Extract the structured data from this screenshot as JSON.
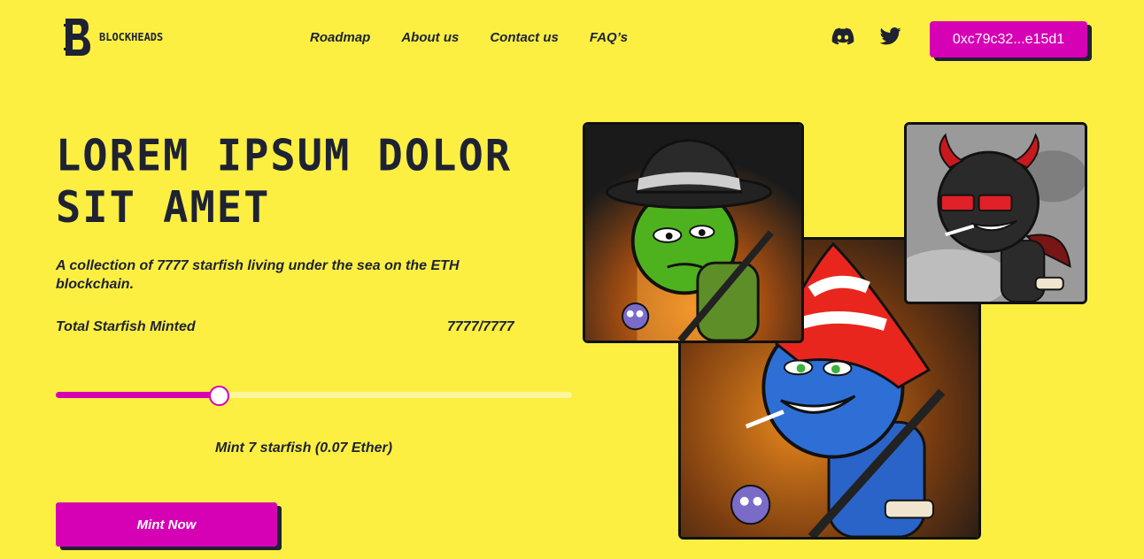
{
  "header": {
    "logo_text": "BLOCKHEADS",
    "nav": [
      "Roadmap",
      "About us",
      "Contact us",
      "FAQ’s"
    ],
    "social_icons": [
      "discord-icon",
      "twitter-icon"
    ],
    "wallet_address": "0xc79c32...e15d1"
  },
  "hero": {
    "title": "LOREM IPSUM DOLOR SIT AMET",
    "subtitle": "A collection of 7777 starfish living under the sea on the ETH blockchain.",
    "minted_label": "Total Starfish Minted",
    "minted_value": "7777/7777",
    "slider_fraction": 0.315,
    "mint_info": "Mint 7 starfish (0.07 Ether)",
    "mint_button": "Mint Now"
  },
  "gallery": {
    "images": [
      "green-blockhead-nft",
      "blue-blockhead-nft",
      "devil-blockhead-nft"
    ]
  },
  "colors": {
    "background": "#FCEF42",
    "accent": "#D600B4",
    "text": "#1E2233"
  }
}
